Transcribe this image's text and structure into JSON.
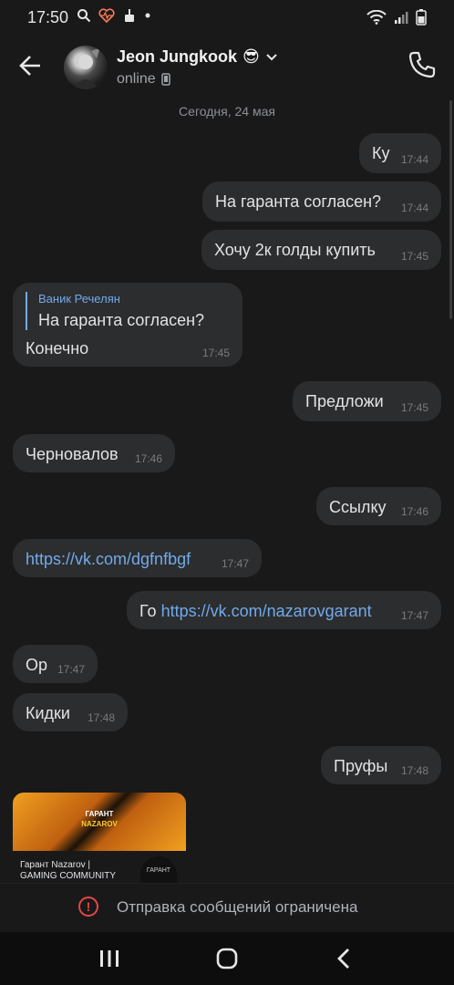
{
  "status_bar": {
    "time": "17:50",
    "icons": [
      "search-icon",
      "heart-rate-icon",
      "cleaner-icon",
      "dot-icon"
    ],
    "right_icons": [
      "wifi-icon",
      "signal-icon",
      "battery-icon"
    ]
  },
  "header": {
    "name": "Jeon Jungkook",
    "emoji": "😎",
    "status": "online"
  },
  "date_divider": "Сегодня, 24 мая",
  "messages": [
    {
      "text": "Ку",
      "time": "17:44"
    },
    {
      "text": "На гаранта согласен?",
      "time": "17:44"
    },
    {
      "text": "Хочу 2к голды купить",
      "time": "17:45"
    },
    {
      "reply_author": "Ваник Речелян",
      "reply_text": "На гаранта согласен?",
      "text": "Конечно",
      "time": "17:45"
    },
    {
      "text": "Предложи",
      "time": "17:45"
    },
    {
      "text": "Черновалов",
      "time": "17:46"
    },
    {
      "text": "Ссылку",
      "time": "17:46"
    },
    {
      "text": "https://vk.com/dgfnfbgf",
      "time": "17:47"
    },
    {
      "prefix": "Го ",
      "link": "https://vk.com/nazarovgarant",
      "time": "17:47"
    },
    {
      "text": "Ор",
      "time": "17:47"
    },
    {
      "text": "Кидки",
      "time": "17:48"
    },
    {
      "text": "Пруфы",
      "time": "17:48"
    }
  ],
  "link_card": {
    "brand_line1": "ГАРАНТ",
    "brand_line2": "NAZAROV",
    "title": "Гарант Nazarov | GAMING COMMUNITY",
    "logo_text": "ГАРАНТ"
  },
  "restricted": {
    "icon": "!",
    "label": "Отправка сообщений ограничена",
    "color": "#e64646"
  },
  "colors": {
    "background": "#19191a",
    "bubble": "#2c2d2e",
    "link": "#71aaeb"
  }
}
